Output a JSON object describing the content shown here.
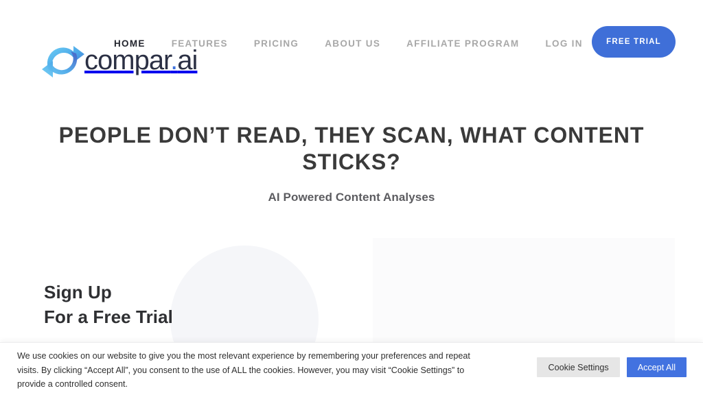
{
  "brand": {
    "logo_icon": "circular-arrows-icon",
    "wordmark_main": "compar",
    "wordmark_dot": ".",
    "wordmark_suffix": "ai",
    "wordmark_full": "compar.ai",
    "accent_blue": "#3f6fd8",
    "logo_gradient_from": "#5ec8f2",
    "logo_gradient_to": "#4a5fc4",
    "wordmark_color": "#2b3044"
  },
  "nav": {
    "items": [
      {
        "label": "HOME",
        "active": true
      },
      {
        "label": "FEATURES",
        "active": false
      },
      {
        "label": "PRICING",
        "active": false
      },
      {
        "label": "ABOUT US",
        "active": false
      },
      {
        "label": "AFFILIATE PROGRAM",
        "active": false
      },
      {
        "label": "LOG IN",
        "active": false
      }
    ],
    "cta_label": "FREE TRIAL",
    "cta_color": "#3f6fd8",
    "active_color": "#23252e",
    "inactive_color": "#a8a8a8"
  },
  "hero": {
    "title": "PEOPLE DON’T READ, THEY SCAN, WHAT CONTENT STICKS?",
    "subtitle": "AI Powered Content Analyses",
    "title_color": "#3a3a3a",
    "subtitle_color": "#5c5c60"
  },
  "signup": {
    "line1": "Sign Up",
    "line2": "For a Free Trial",
    "color": "#2f3033"
  },
  "decor": {
    "circle_color": "#f3f4f8",
    "panel_color": "#fbfbfc"
  },
  "cookie": {
    "message": "We use cookies on our website to give you the most relevant experience by remembering your preferences and repeat visits. By clicking “Accept All”, you consent to the use of ALL the cookies. However, you may visit “Cookie Settings” to provide a controlled consent.",
    "settings_label": "Cookie Settings",
    "accept_label": "Accept All",
    "settings_bg": "#e6e6e6",
    "accept_bg": "#4272e0"
  }
}
